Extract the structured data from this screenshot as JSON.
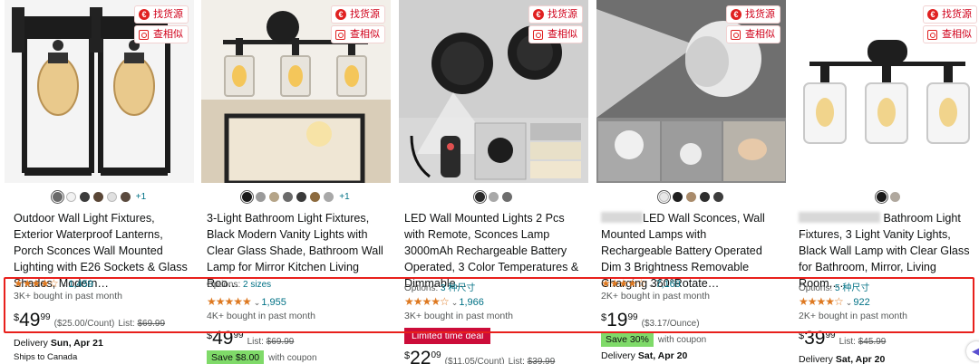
{
  "extension": {
    "find_source": "找货源",
    "find_similar": "查相似"
  },
  "products": [
    {
      "title": "Outdoor Wall Light Fixtures, Exterior Waterproof Lanterns, Porch Sconces Wall Mounted Lighting with E26 Sockets & Glass Shades, Modern…",
      "swatch_colors": [
        "#6a6a6a",
        "#f2f2f2",
        "#3b3b3b",
        "#5a4636",
        "#e0e0e0",
        "#5a4a3e"
      ],
      "swatch_more": "+1",
      "stars": "★★★★☆",
      "rating_count": "1,459",
      "bought": "3K+ bought in past month",
      "price_symbol": "$",
      "price_whole": "49",
      "price_fraction": "99",
      "unit_price": "($25.00/Count)",
      "list_label": "List:",
      "list_price": "$69.99",
      "delivery_label": "Delivery",
      "delivery_date": "Sun, Apr 21",
      "ships_to": "Ships to Canada"
    },
    {
      "title": "3-Light Bathroom Light Fixtures, Black Modern Vanity Lights with Clear Glass Shade, Bathroom Wall Lamp for Mirror Kitchen Living Roo…",
      "swatch_colors": [
        "#1a1a1a",
        "#9a9a9a",
        "#b5a488",
        "#6b6b6b",
        "#3a3a3a",
        "#8c6a3e",
        "#a8a8a8"
      ],
      "swatch_more": "+1",
      "options_label": "Options:",
      "options_value": "2 sizes",
      "stars": "★★★★★",
      "rating_count": "1,955",
      "bought": "4K+ bought in past month",
      "price_symbol": "$",
      "price_whole": "49",
      "price_fraction": "99",
      "list_label": "List:",
      "list_price": "$69.99",
      "coupon_badge": "Save $8.00",
      "coupon_text": "with coupon"
    },
    {
      "title": "LED Wall Mounted Lights 2 Pcs with Remote, Sconces Lamp 3000mAh Rechargeable Battery Operated, 3 Color Temperatures & Dimmable…",
      "swatch_colors": [
        "#2a2a2a",
        "#a8a8a8",
        "#6d6d6d"
      ],
      "options_label": "Options:",
      "options_value": "3 种尺寸",
      "stars": "★★★★☆",
      "rating_count": "1,966",
      "bought": "3K+ bought in past month",
      "deal_badge": "Limited time deal",
      "price_symbol": "$",
      "price_whole": "22",
      "price_fraction": "09",
      "unit_price": "($11.05/Count)",
      "list_label": "List:",
      "list_price": "$39.99"
    },
    {
      "title_suffix": "LED Wall Sconces, Wall Mounted Lamps with Rechargeable Battery Operated Dim 3 Brightness Removable Charging 360°Rotate…",
      "swatch_colors": [
        "#e8e8e8",
        "#1f1f1f",
        "#a98b6b",
        "#2e2e2e",
        "#3d3d3d"
      ],
      "stars": "★★★★☆",
      "rating_count": "7,169",
      "bought": "2K+ bought in past month",
      "price_symbol": "$",
      "price_whole": "19",
      "price_fraction": "99",
      "unit_price": "($3.17/Ounce)",
      "coupon_badge": "Save 30%",
      "coupon_text": "with coupon",
      "delivery_label": "Delivery",
      "delivery_date": "Sat, Apr 20"
    },
    {
      "title_suffix": "Bathroom Light Fixtures, 3 Light Vanity Lights, Black Wall Lamp with Clear Glass for Bathroom, Mirror, Living Room,…",
      "swatch_colors": [
        "#1a1a1a",
        "#b0a89e"
      ],
      "options_label": "Options:",
      "options_value": "5 种尺寸",
      "stars": "★★★★☆",
      "rating_count": "922",
      "bought": "2K+ bought in past month",
      "price_symbol": "$",
      "price_whole": "39",
      "price_fraction": "99",
      "list_label": "List:",
      "list_price": "$45.99",
      "delivery_label": "Delivery",
      "delivery_date": "Sat, Apr 20"
    }
  ]
}
